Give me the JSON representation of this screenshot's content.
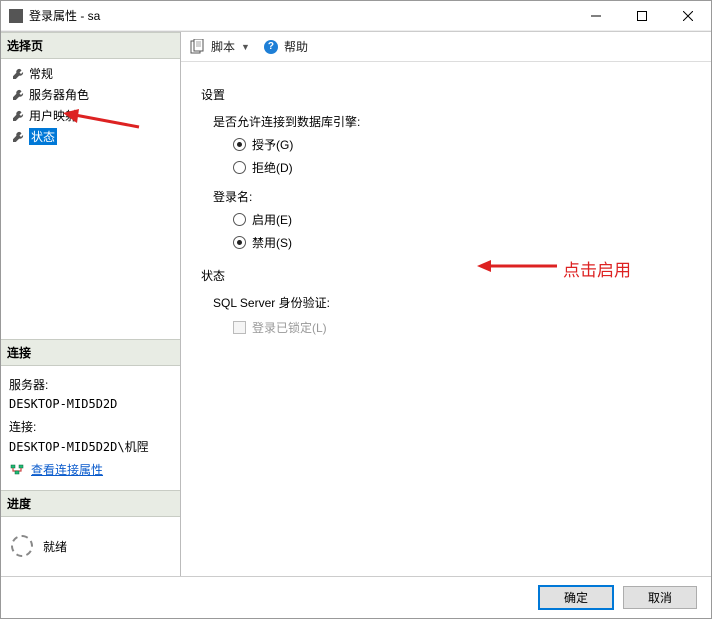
{
  "titlebar": {
    "title": "登录属性 - sa"
  },
  "left": {
    "select_page": "选择页",
    "nav": [
      {
        "label": "常规"
      },
      {
        "label": "服务器角色"
      },
      {
        "label": "用户映射"
      },
      {
        "label": "状态"
      }
    ],
    "connection_header": "连接",
    "server_label": "服务器:",
    "server_value": "DESKTOP-MID5D2D",
    "conn_label": "连接:",
    "conn_value": "DESKTOP-MID5D2D\\机陧",
    "view_props": "查看连接属性",
    "progress_header": "进度",
    "ready": "就绪"
  },
  "toolbar": {
    "script": "脚本",
    "help": "帮助"
  },
  "content": {
    "settings": "设置",
    "q_connect": "是否允许连接到数据库引擎:",
    "grant": "授予(G)",
    "deny": "拒绝(D)",
    "login_name": "登录名:",
    "enable": "启用(E)",
    "disable": "禁用(S)",
    "status": "状态",
    "sql_auth": "SQL Server 身份验证:",
    "login_locked": "登录已锁定(L)"
  },
  "annotation": {
    "text": "点击启用"
  },
  "footer": {
    "ok": "确定",
    "cancel": "取消"
  }
}
